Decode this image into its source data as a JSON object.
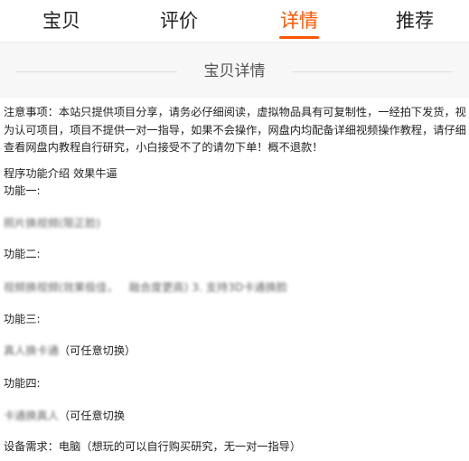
{
  "tabs": [
    {
      "label": "宝贝",
      "active": false
    },
    {
      "label": "评价",
      "active": false
    },
    {
      "label": "详情",
      "active": true
    },
    {
      "label": "推荐",
      "active": false
    }
  ],
  "colors": {
    "accent": "#ff5500",
    "header_bg": "#f7f7f7"
  },
  "section": {
    "title": "宝贝详情"
  },
  "detail": {
    "notice": "注意事项：本站只提供项目分享，请务必仔细阅读，虚拟物品具有可复制性，一经拍下发货，视为认可项目，项目不提供一对一指导，如果不会操作，网盘内均配备详细视频操作教程，请仔细查看网盘内教程自行研究，小白接受不了的请勿下单！概不退款！",
    "intro": "程序功能介绍 效果牛逼",
    "f1_title": "功能一:",
    "f1_desc": "照片换视频(限正脸)",
    "f2_title": "功能二:",
    "f2_desc_a": "视频换视频(效果极佳，",
    "f2_desc_b": "融合度更高) 3. 支持3D卡通换脸",
    "f3_title": "功能三:",
    "f3_desc_blur": "真人换卡通",
    "f3_desc_clear": "（可任意切换）",
    "f4_title": "功能四:",
    "f4_desc_blur": "卡通换真人",
    "f4_desc_clear": "（可任意切换",
    "device": "设备需求：电脑（想玩的可以自行购买研究，无一对一指导）"
  }
}
